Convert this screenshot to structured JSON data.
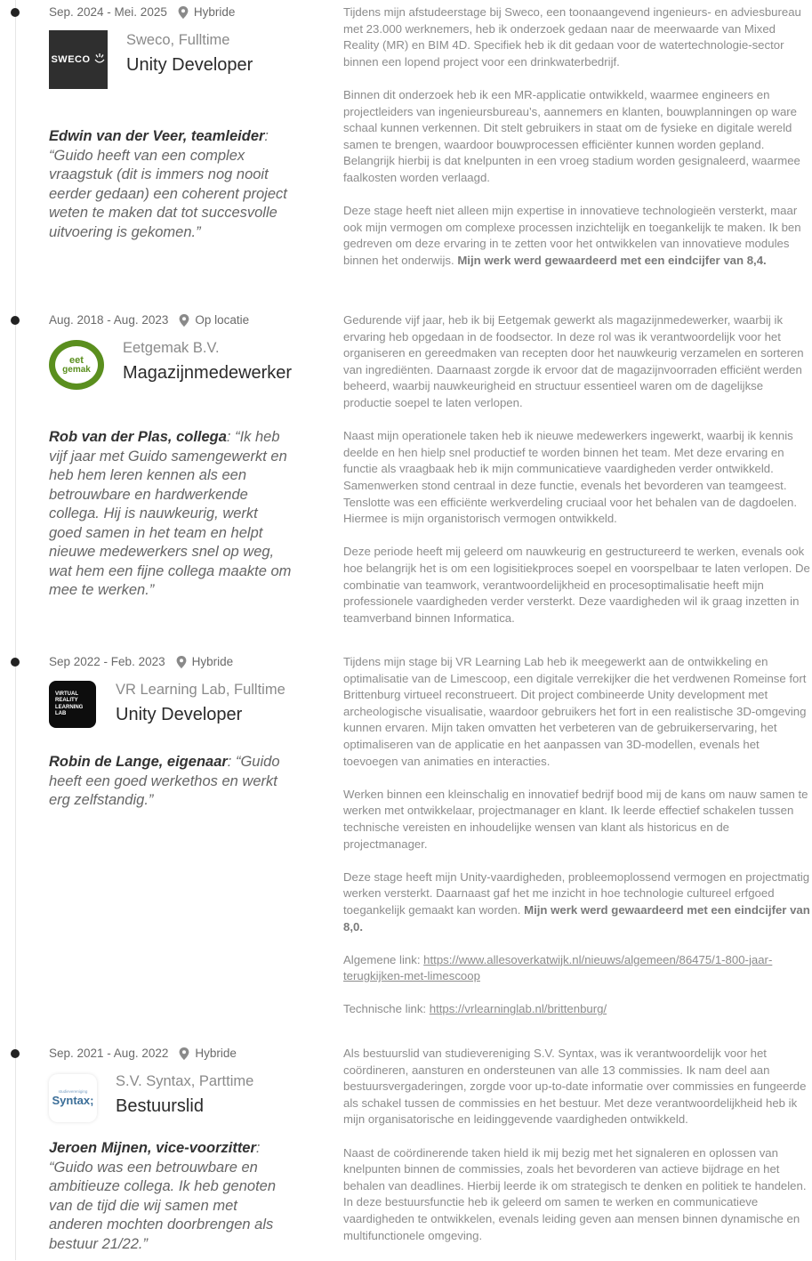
{
  "entries": [
    {
      "period": "Sep. 2024 - Mei. 2025",
      "location": "Hybride",
      "company": "Sweco, Fulltime",
      "role": "Unity Developer",
      "logo_text": "SWECO",
      "logo_bg": "#2f2f2f",
      "quote_author": "Edwin van der Veer",
      "quote_role": "teamleider",
      "quote_text": "“Guido heeft van een complex vraagstuk (dit is immers nog nooit eerder gedaan) een coherent project weten te maken dat tot succesvolle uitvoering is gekomen.”",
      "paragraphs": [
        "Tijdens mijn afstudeerstage bij Sweco, een toonaangevend ingenieurs- en adviesbureau met 23.000 werknemers, heb ik onderzoek gedaan naar de meerwaarde van Mixed Reality (MR) en BIM 4D. Specifiek heb ik dit gedaan voor de watertechnologie-sector binnen een lopend project voor een drinkwaterbedrijf.",
        "Binnen dit onderzoek heb ik een MR-applicatie ontwikkeld, waarmee engineers en projectleiders van ingenieursbureau’s, aannemers en klanten, bouwplanningen op ware schaal kunnen verkennen. Dit stelt gebruikers in staat om de fysieke en digitale wereld samen te brengen, waardoor bouwprocessen efficiënter kunnen worden gepland. Belangrijk hierbij is dat knelpunten in een vroeg stadium worden gesignaleerd, waarmee faalkosten worden verlaagd.",
        "Deze stage heeft niet alleen mijn expertise in innovatieve technologieën versterkt, maar ook mijn vermogen om complexe processen inzichtelijk en toegankelijk te maken. Ik ben gedreven om deze ervaring in te zetten voor het ontwikkelen van innovatieve modules binnen het onderwijs."
      ],
      "highlight": "Mijn werk werd gewaardeerd met een eindcijfer van 8,4."
    },
    {
      "period": "Aug. 2018 - Aug. 2023",
      "location": "Op locatie",
      "company": "Eetgemak B.V.",
      "role": "Magazijnmedewerker",
      "logo_text_1": "eet",
      "logo_text_2": "gemak",
      "logo_color": "#5a8f1e",
      "quote_author": "Rob van der Plas",
      "quote_role": "collega",
      "quote_text": "“Ik heb vijf jaar met Guido samengewerkt en heb hem leren kennen als een betrouwbare en hardwerkende collega. Hij is nauwkeurig, werkt goed samen in het team en helpt nieuwe medewerkers snel op weg, wat hem een fijne collega maakte om mee te werken.”",
      "paragraphs": [
        "Gedurende vijf jaar, heb ik bij Eetgemak gewerkt als magazijnmedewerker, waarbij ik ervaring heb opgedaan in de foodsector. In deze rol was ik verantwoordelijk voor het organiseren en gereedmaken van recepten door het nauwkeurig verzamelen en sorteren van ingrediënten. Daarnaast zorgde ik ervoor dat de magazijnvoorraden efficiënt werden beheerd, waarbij nauwkeurigheid en structuur essentieel waren om de dagelijkse productie soepel te laten verlopen.",
        "Naast mijn operationele taken heb ik nieuwe medewerkers ingewerkt, waarbij ik kennis deelde en hen hielp snel productief te worden binnen het team. Met deze ervaring en functie als vraagbaak heb ik mijn communicatieve vaardigheden verder ontwikkeld. Samenwerken stond centraal in deze functie, evenals het bevorderen van teamgeest. Tenslotte was een efficiënte werkverdeling cruciaal voor het behalen van de dagdoelen. Hiermee is mijn organistorisch vermogen ontwikkeld.",
        "Deze periode heeft mij geleerd om nauwkeurig en gestructureerd te werken, evenals ook hoe belangrijk het is om een logisitiekproces soepel en voorspelbaar te laten verlopen. De combinatie van teamwork, verantwoordelijkheid en procesoptimalisatie heeft mijn professionele vaardigheden verder versterkt. Deze vaardigheden wil ik graag inzetten in teamverband binnen Informatica."
      ]
    },
    {
      "period": "Sep 2022 - Feb. 2023",
      "location": "Hybride",
      "company": "VR Learning Lab, Fulltime",
      "role": "Unity Developer",
      "logo_lines": [
        "VIRTUAL",
        "REALITY",
        "LEARNING",
        "LAB"
      ],
      "logo_bg": "#0d0d0d",
      "quote_author": "Robin de Lange",
      "quote_role": "eigenaar",
      "quote_text": "“Guido heeft een goed werkethos en werkt erg zelfstandig.”",
      "paragraphs": [
        "Tijdens mijn stage bij VR Learning Lab heb ik meegewerkt aan de ontwikkeling en optimalisatie van de Limescoop, een digitale verrekijker die het verdwenen Romeinse fort Brittenburg virtueel reconstrueert. Dit project combineerde Unity development met archeologische visualisatie, waardoor gebruikers het fort in een realistische 3D-omgeving kunnen ervaren. Mijn taken omvatten het verbeteren van de gebruikerservaring, het optimaliseren van de applicatie en het aanpassen van 3D-modellen, evenals het toevoegen van animaties en interacties.",
        "Werken binnen een kleinschalig en innovatief bedrijf bood mij de kans om nauw samen te werken met ontwikkelaar, projectmanager en klant. Ik leerde effectief schakelen tussen technische vereisten en inhoudelijke wensen van klant als historicus en de projectmanager.",
        "Deze stage heeft mijn Unity-vaardigheden, probleemoplossend vermogen en projectmatig werken versterkt. Daarnaast gaf het me inzicht in hoe technologie cultureel erfgoed toegankelijk gemaakt kan worden."
      ],
      "highlight": "Mijn werk werd gewaardeerd met een eindcijfer van 8,0.",
      "link1_label": "Algemene link:",
      "link1_text": "https://www.allesoverkatwijk.nl/nieuws/algemeen/86475/1-800-jaar-terugkijken-met-limescoop",
      "link2_label": "Technische link:",
      "link2_text": "https://vrlearninglab.nl/brittenburg/"
    },
    {
      "period": "Sep. 2021 - Aug. 2022",
      "location": "Hybride",
      "company": "S.V. Syntax, Parttime",
      "role": "Bestuurslid",
      "logo_text": "Syntax;",
      "logo_sub": "studievereniging",
      "quote_author": "Jeroen Mijnen",
      "quote_role": "vice-voorzitter",
      "quote_text": "“Guido was een betrouwbare en ambitieuze collega. Ik heb genoten van de tijd die wij samen met anderen mochten doorbrengen als bestuur 21/22.”",
      "paragraphs": [
        "Als bestuurslid van studievereniging S.V. Syntax, was ik verantwoordelijk voor het coördineren, aansturen en ondersteunen van alle 13 commissies. Ik nam deel aan bestuursvergaderingen, zorgde voor up-to-date informatie over commissies en fungeerde als schakel tussen de commissies en het bestuur. Met deze verantwoordelijkheid heb ik mijn organisatorische en leidinggevende vaardigheden ontwikkeld.",
        "Naast de coördinerende taken hield ik mij bezig met het signaleren en oplossen van knelpunten binnen de commissies, zoals het bevorderen van actieve bijdrage en het behalen van deadlines. Hierbij leerde ik om strategisch te denken en politiek te handelen. In deze bestuursfunctie heb ik geleerd om samen te werken en communicatieve vaardigheden te ontwikkelen, evenals leiding geven aan mensen binnen dynamische en multifunctionele omgeving."
      ]
    }
  ]
}
